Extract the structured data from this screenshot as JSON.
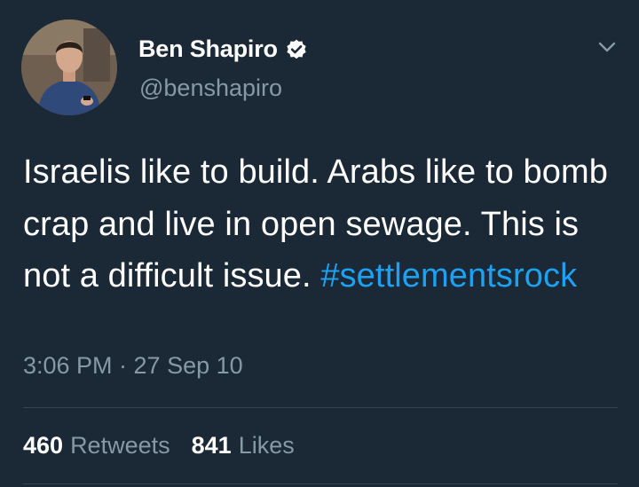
{
  "author": {
    "display_name": "Ben Shapiro",
    "handle": "@benshapiro",
    "verified": true
  },
  "tweet": {
    "text": "Israelis like to build. Arabs like to bomb crap and live in open sewage. This is not a difficult issue. ",
    "hashtag": "#settlementsrock",
    "timestamp": "3:06 PM · 27 Sep 10"
  },
  "stats": {
    "retweets_count": "460",
    "retweets_label": "Retweets",
    "likes_count": "841",
    "likes_label": "Likes"
  },
  "icons": {
    "menu": "chevron-down-icon",
    "verified": "verified-badge-icon"
  },
  "colors": {
    "background": "#1b2836",
    "text": "#ffffff",
    "secondary_text": "#8899a6",
    "link": "#1da1f2",
    "divider": "#38444d"
  }
}
